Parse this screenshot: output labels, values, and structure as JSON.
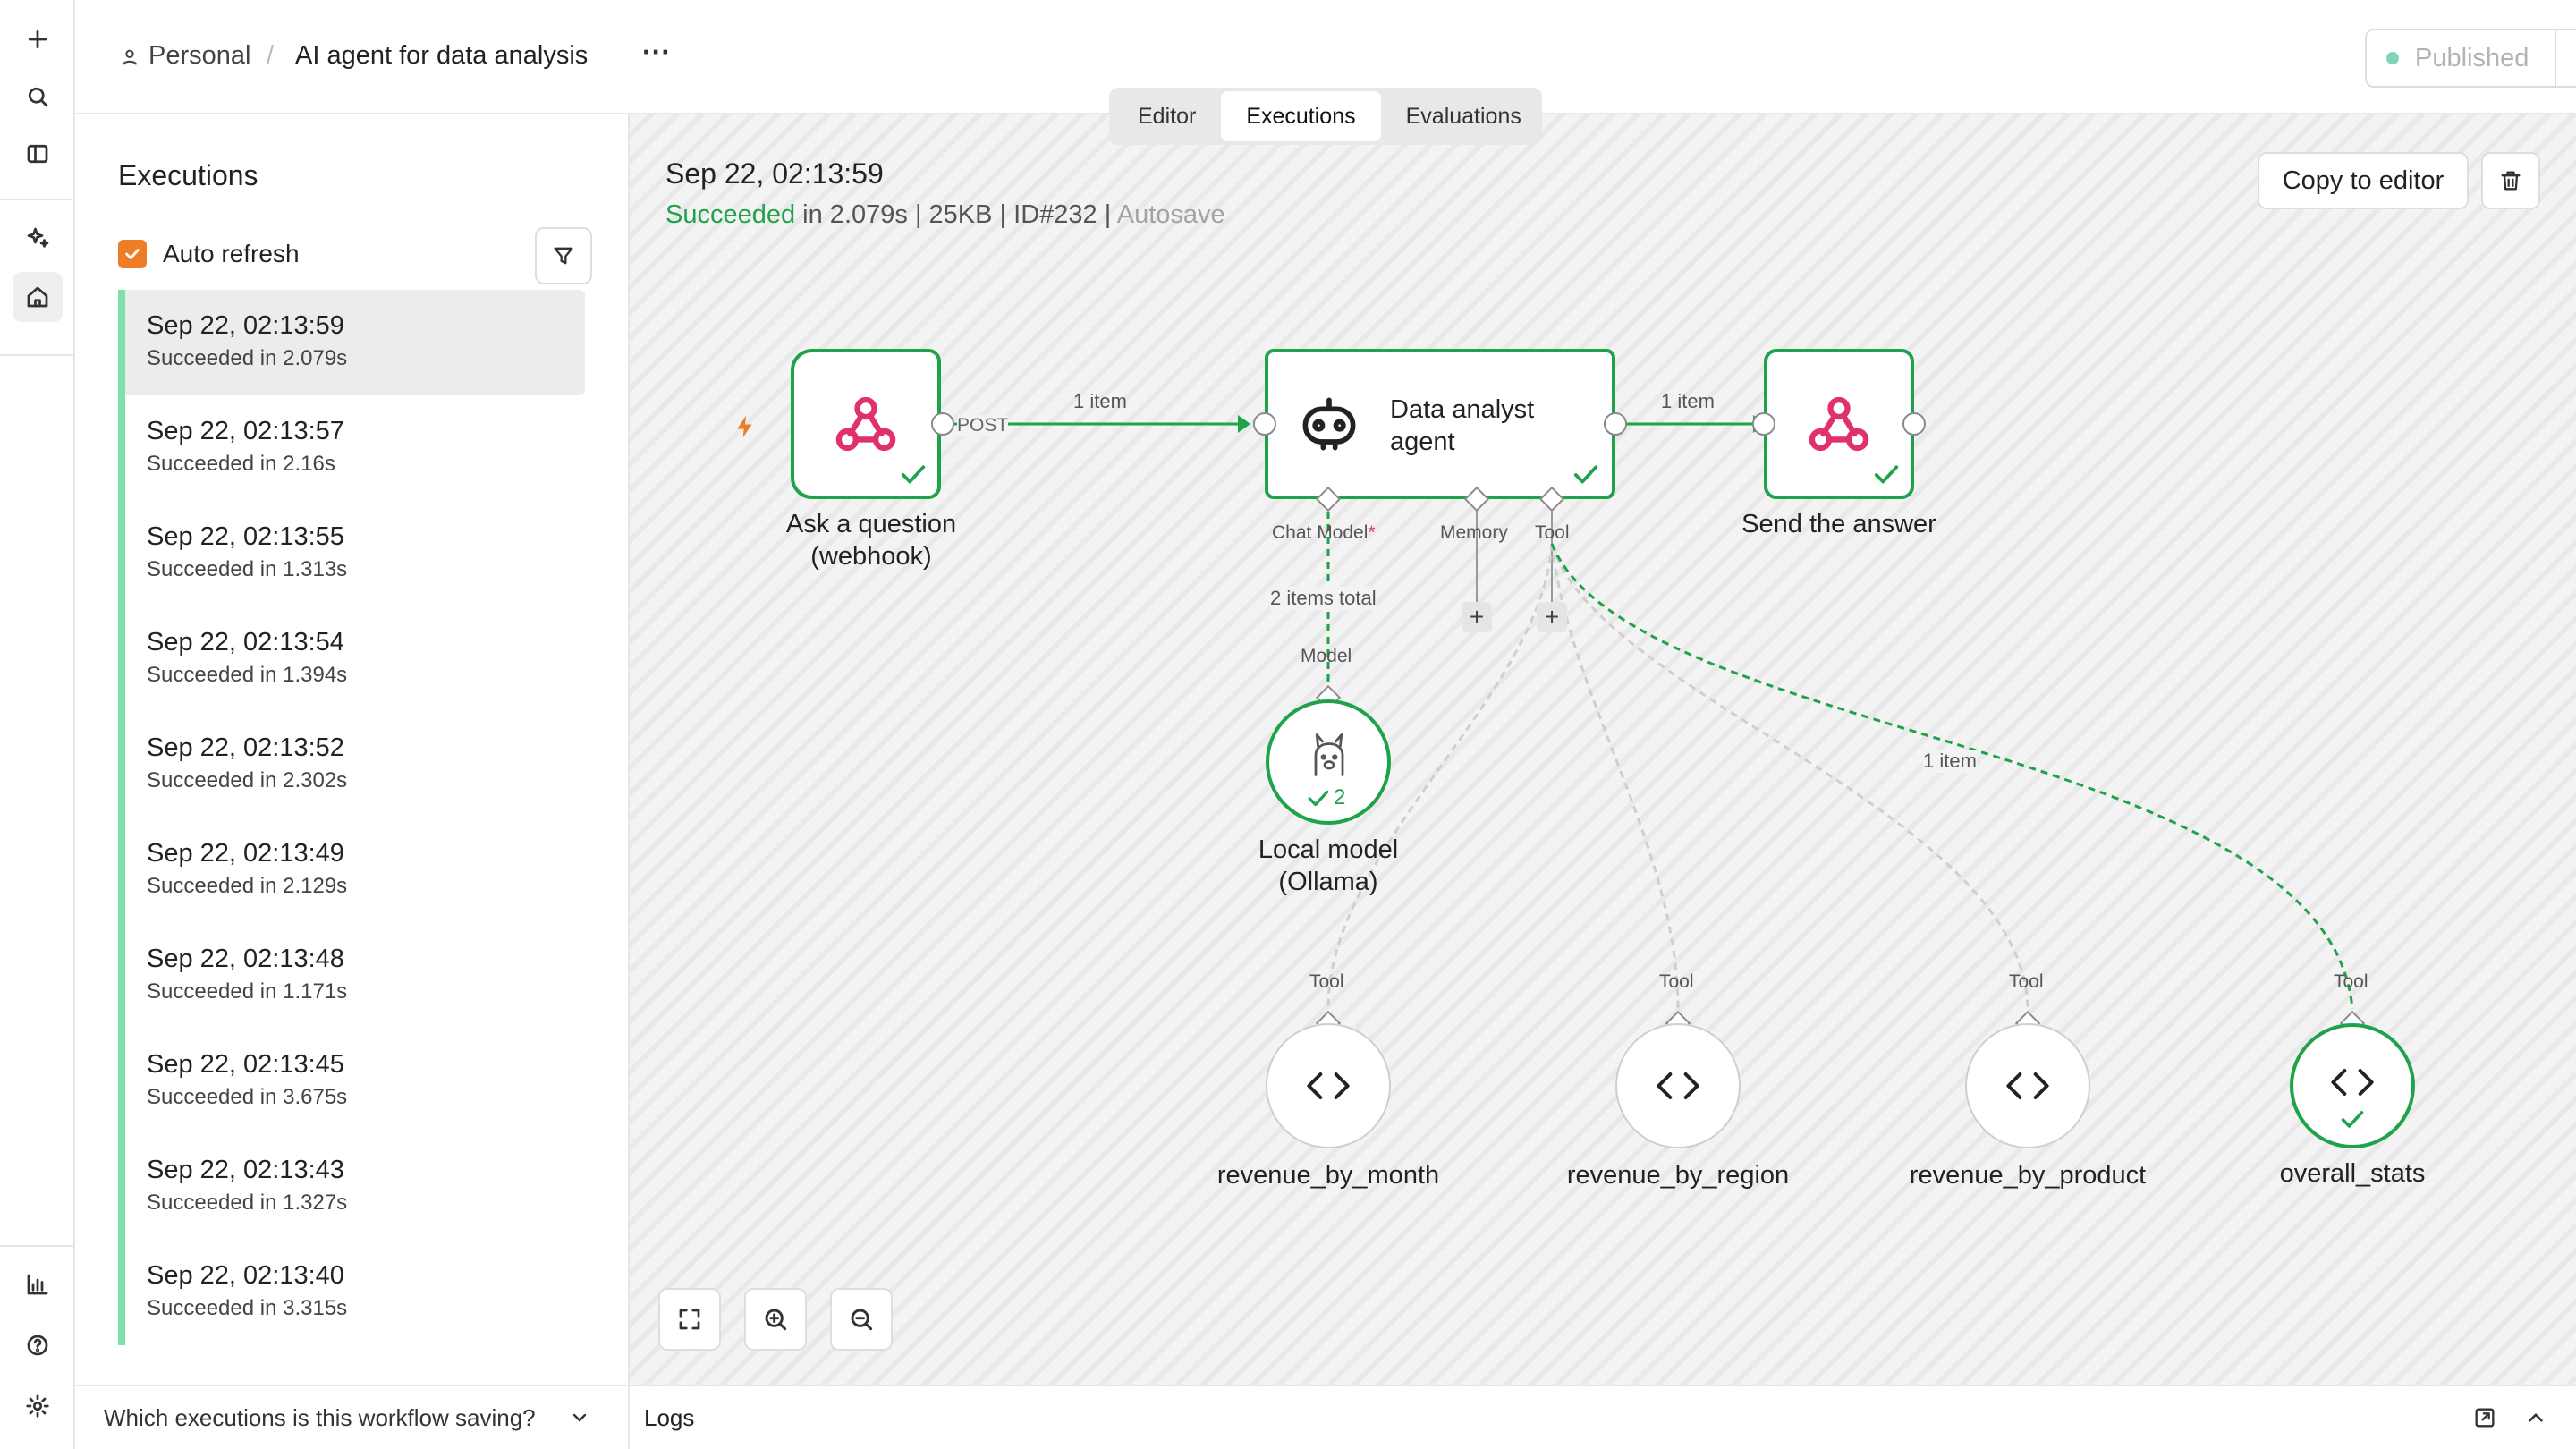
{
  "breadcrumb": {
    "project": "Personal",
    "separator": "/",
    "workflow": "AI agent for data analysis",
    "more": "···"
  },
  "publish": {
    "label": "Published",
    "status_color": "#7fd6b5"
  },
  "tabs": [
    {
      "label": "Editor"
    },
    {
      "label": "Executions"
    },
    {
      "label": "Evaluations"
    }
  ],
  "sidebar": {
    "title": "Executions",
    "auto_refresh_label": "Auto refresh",
    "auto_refresh_checked": true,
    "items": [
      {
        "date": "Sep 22, 02:13:59",
        "status": "Succeeded in 2.079s"
      },
      {
        "date": "Sep 22, 02:13:57",
        "status": "Succeeded in 2.16s"
      },
      {
        "date": "Sep 22, 02:13:55",
        "status": "Succeeded in 1.313s"
      },
      {
        "date": "Sep 22, 02:13:54",
        "status": "Succeeded in 1.394s"
      },
      {
        "date": "Sep 22, 02:13:52",
        "status": "Succeeded in 2.302s"
      },
      {
        "date": "Sep 22, 02:13:49",
        "status": "Succeeded in 2.129s"
      },
      {
        "date": "Sep 22, 02:13:48",
        "status": "Succeeded in 1.171s"
      },
      {
        "date": "Sep 22, 02:13:45",
        "status": "Succeeded in 3.675s"
      },
      {
        "date": "Sep 22, 02:13:43",
        "status": "Succeeded in 1.327s"
      },
      {
        "date": "Sep 22, 02:13:40",
        "status": "Succeeded in 3.315s"
      }
    ],
    "footer": "Which executions is this workflow saving?"
  },
  "execution": {
    "date": "Sep 22, 02:13:59",
    "status": "Succeeded",
    "duration": " in 2.079s",
    "sep1": " | ",
    "size": "25KB",
    "sep2": " | ",
    "id": "ID#232",
    "sep3": " | ",
    "autosave": "Autosave",
    "copy_label": "Copy to editor"
  },
  "workflow": {
    "trigger": {
      "label": "Ask a question (webhook)",
      "port_label": "POST"
    },
    "edge_trigger_agent": "1 item",
    "agent": {
      "label_line1": "Data analyst",
      "label_line2": "agent",
      "ports": {
        "chat_model": "Chat Model",
        "required_mark": "*",
        "memory": "Memory",
        "tool": "Tool"
      }
    },
    "edge_agent_send": "1 item",
    "send": {
      "label": "Send the answer"
    },
    "model_edge_label": "2 items total",
    "model": {
      "port_label": "Model",
      "label_line1": "Local model",
      "label_line2": "(Ollama)",
      "run_count": "2"
    },
    "tool_edge_label": "1 item",
    "tools": [
      {
        "name": "revenue_by_month",
        "port_label": "Tool"
      },
      {
        "name": "revenue_by_region",
        "port_label": "Tool"
      },
      {
        "name": "revenue_by_product",
        "port_label": "Tool"
      },
      {
        "name": "overall_stats",
        "port_label": "Tool"
      }
    ],
    "plus": "+"
  },
  "logs": {
    "label": "Logs"
  },
  "colors": {
    "success": "#1fa34a",
    "accent": "#ef7c27",
    "webhook": "#e0306f"
  }
}
